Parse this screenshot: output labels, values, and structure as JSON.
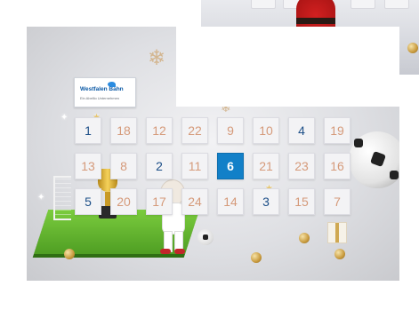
{
  "logo": {
    "name": "Westfalen Bahn",
    "tagline": "Ein Abellio Unternehmen"
  },
  "calendar": {
    "doors": [
      {
        "num": "1",
        "style": "blue"
      },
      {
        "num": "18",
        "style": "normal"
      },
      {
        "num": "12",
        "style": "normal"
      },
      {
        "num": "22",
        "style": "normal"
      },
      {
        "num": "9",
        "style": "normal"
      },
      {
        "num": "10",
        "style": "normal"
      },
      {
        "num": "4",
        "style": "blue"
      },
      {
        "num": "19",
        "style": "normal"
      },
      {
        "num": "13",
        "style": "normal"
      },
      {
        "num": "8",
        "style": "normal"
      },
      {
        "num": "2",
        "style": "blue"
      },
      {
        "num": "11",
        "style": "normal"
      },
      {
        "num": "6",
        "style": "today"
      },
      {
        "num": "21",
        "style": "normal"
      },
      {
        "num": "23",
        "style": "normal"
      },
      {
        "num": "16",
        "style": "normal"
      },
      {
        "num": "5",
        "style": "blue"
      },
      {
        "num": "20",
        "style": "normal"
      },
      {
        "num": "17",
        "style": "normal"
      },
      {
        "num": "24",
        "style": "normal"
      },
      {
        "num": "14",
        "style": "normal"
      },
      {
        "num": "3",
        "style": "blue"
      },
      {
        "num": "15",
        "style": "normal"
      },
      {
        "num": "7",
        "style": "normal"
      }
    ]
  },
  "colors": {
    "today_door": "#1280c8",
    "opened_number": "#1d4f88",
    "closed_number": "#d59a7a"
  }
}
